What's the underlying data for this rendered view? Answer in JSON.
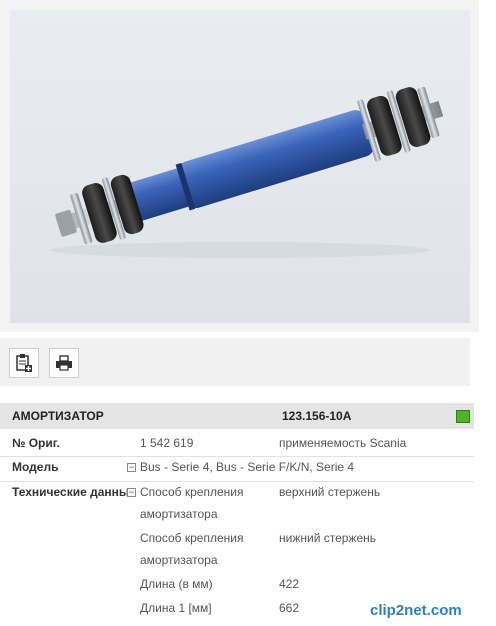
{
  "product": {
    "image_alt": "shock-absorber-photo",
    "name": "АМОРТИЗАТОР",
    "code": "123.156-10A",
    "stock_color": "#4bb523"
  },
  "toolbar": {
    "icons": [
      "add-to-notes-icon",
      "print-icon"
    ]
  },
  "specs": {
    "orig_label": "№ Ориг.",
    "orig_value": "1 542 619",
    "orig_note": "применяемость Scania",
    "model_label": "Модель",
    "model_toggle": "−",
    "model_value": "Bus - Serie 4, Bus - Serie F/K/N, Serie 4",
    "tech_label": "Технические данные",
    "tech_toggle": "−",
    "tech": [
      {
        "name_line1": "Способ крепления",
        "name_line2": "амортизатора",
        "value": "верхний стержень"
      },
      {
        "name_line1": "Способ крепления",
        "name_line2": "амортизатора",
        "value": "нижний стержень"
      },
      {
        "name_line1": "Длина (в мм)",
        "name_line2": "",
        "value": "422"
      },
      {
        "name_line1": "Длина 1 [мм]",
        "name_line2": "",
        "value": "662"
      }
    ]
  },
  "watermark": {
    "text": "clip2net.com"
  }
}
